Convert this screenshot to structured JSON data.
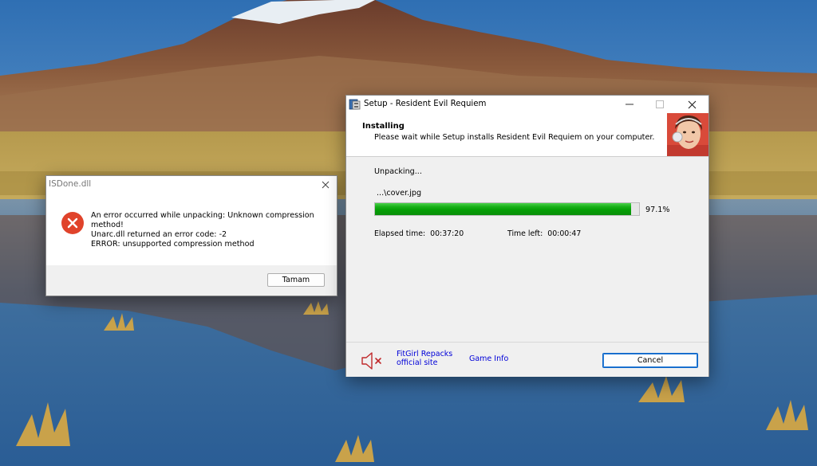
{
  "isdone_dialog": {
    "title": "ISDone.dll",
    "message_lines": [
      "An error occurred while unpacking: Unknown compression",
      "method!",
      "Unarc.dll returned an error code: -2",
      "ERROR: unsupported compression method"
    ],
    "ok_label": "Tamam"
  },
  "setup_window": {
    "title": "Setup - Resident Evil Requiem",
    "header_title": "Installing",
    "header_subtitle": "Please wait while Setup installs Resident Evil Requiem on your computer.",
    "status_label": "Unpacking...",
    "current_file": "...\\cover.jpg",
    "progress_value": 97.1,
    "progress_text": "97.1%",
    "elapsed_label": "Elapsed time:",
    "elapsed_value": "00:37:20",
    "time_left_label": "Time left:",
    "time_left_value": "00:00:47",
    "link_fitgirl_line1": "FitGirl Repacks",
    "link_fitgirl_line2": "official site",
    "link_game_info": "Game Info",
    "cancel_label": "Cancel"
  },
  "colors": {
    "progress_green": "#0ca00c",
    "error_red": "#e0432b",
    "link_blue": "#0000d8",
    "mute_icon_red": "#c0282a"
  },
  "icons": {
    "error": "error-circle-x-icon",
    "mute": "speaker-muted-icon",
    "app": "setup-app-icon"
  }
}
